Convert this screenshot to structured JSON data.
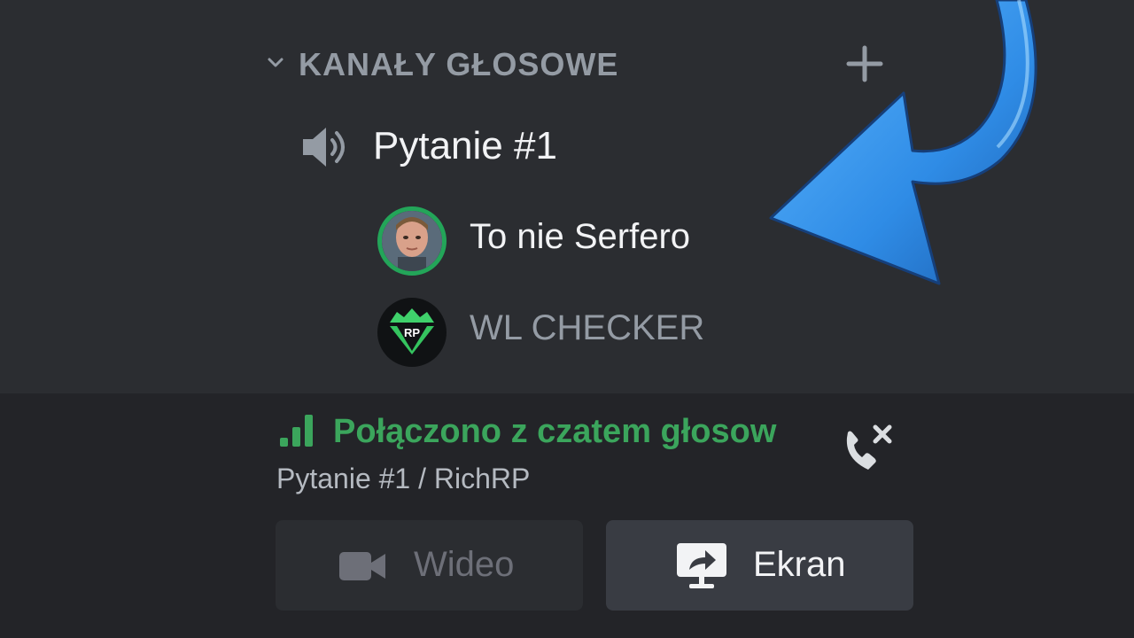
{
  "colors": {
    "background_top": "#2b2d31",
    "background_bottom": "#232428",
    "muted_text": "#949ba4",
    "bright_text": "#f2f3f5",
    "voice_green": "#3ba55c",
    "speaking_ring": "#23a559",
    "disabled_text": "#6d6f78",
    "arrow_blue": "#2f8ce6"
  },
  "category": {
    "title": "KANAŁY GŁOSOWE",
    "chevron_icon": "chevron-down-icon",
    "add_icon": "plus-icon"
  },
  "channel": {
    "name": "Pytanie #1",
    "icon": "speaker-icon"
  },
  "users": [
    {
      "name": "To nie Serfero",
      "speaking": true,
      "avatar": "photo-avatar"
    },
    {
      "name": "WL CHECKER",
      "speaking": false,
      "avatar": "logo-avatar",
      "logo_text": "RP"
    }
  ],
  "voice_status": {
    "title": "Połączono z czatem głosow",
    "subtitle": "Pytanie #1 / RichRP",
    "signal_icon": "signal-bars-icon",
    "disconnect_icon": "phone-disconnect-icon"
  },
  "buttons": {
    "video": {
      "label": "Wideo",
      "icon": "camera-icon",
      "enabled": false
    },
    "screen": {
      "label": "Ekran",
      "icon": "screen-share-icon",
      "enabled": true
    }
  }
}
